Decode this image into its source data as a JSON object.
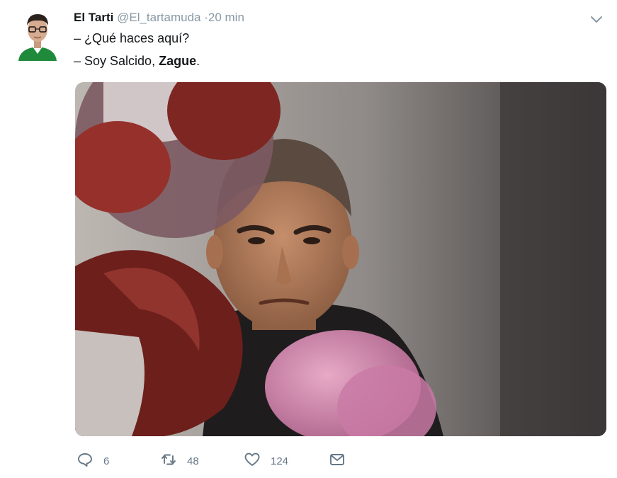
{
  "tweet": {
    "author_name": "El Tarti",
    "author_handle": "@El_tartamuda",
    "time": "·20 min",
    "lines": [
      "– ¿Qué haces aquí?",
      "– Soy Salcido, "
    ],
    "bold_word": "Zague",
    "trailing": ".",
    "avatar_icon": "profile-avatar",
    "menu_icon": "chevron-down-icon"
  },
  "actions": {
    "reply_count": "6",
    "retweet_count": "48",
    "like_count": "124",
    "icons": [
      "reply-icon",
      "retweet-icon",
      "like-icon",
      "message-icon"
    ]
  },
  "colors": {
    "text": "#14171a",
    "muted": "#8899a6",
    "icon": "#657786"
  }
}
